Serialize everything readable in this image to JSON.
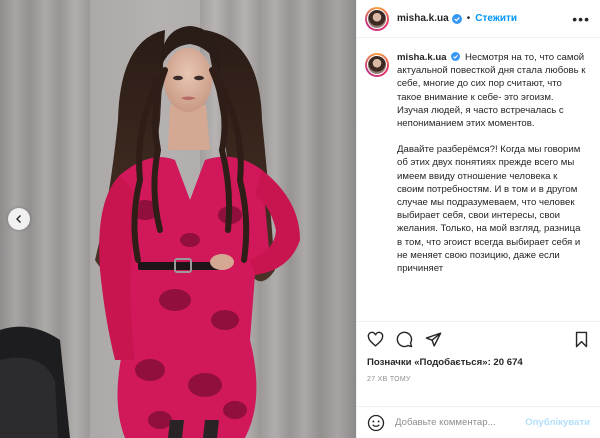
{
  "post": {
    "username": "misha.k.ua",
    "follow_label": "Стежити",
    "more_label": "•••",
    "dot_separator": "•",
    "caption_paragraphs": [
      "Несмотря на то, что самой актуальной повесткой дня стала любовь к себе, многие до сих пор считают, что такое внимание к себе- это эгоизм. Изучая людей, я часто встречалась с непониманием этих моментов.",
      "Давайте разберёмся?! Когда мы говорим об этих двух понятиях прежде всего мы имеем ввиду отношение человека к своим потребностям. И в том и в другом случае мы подразумеваем, что человек выбирает себя, свои интересы, свои желания. Только, на мой взгляд, разница в том, что эгоист всегда выбирает себя и не меняет свою позицию, даже если причиняет"
    ],
    "likes_text": "Позначки «Подобається»: 20 674",
    "timestamp": "27 ХВ ТОМУ",
    "comment_placeholder": "Добавьте комментар...",
    "publish_label": "Опублікувати"
  },
  "colors": {
    "accent": "#0095f6",
    "publish_disabled": "#b2dffc",
    "verified": "#3897f0"
  },
  "icons": [
    "chevron-left-icon",
    "more-icon",
    "verified-badge-icon",
    "heart-icon",
    "comment-icon",
    "share-icon",
    "bookmark-icon",
    "emoji-icon"
  ]
}
